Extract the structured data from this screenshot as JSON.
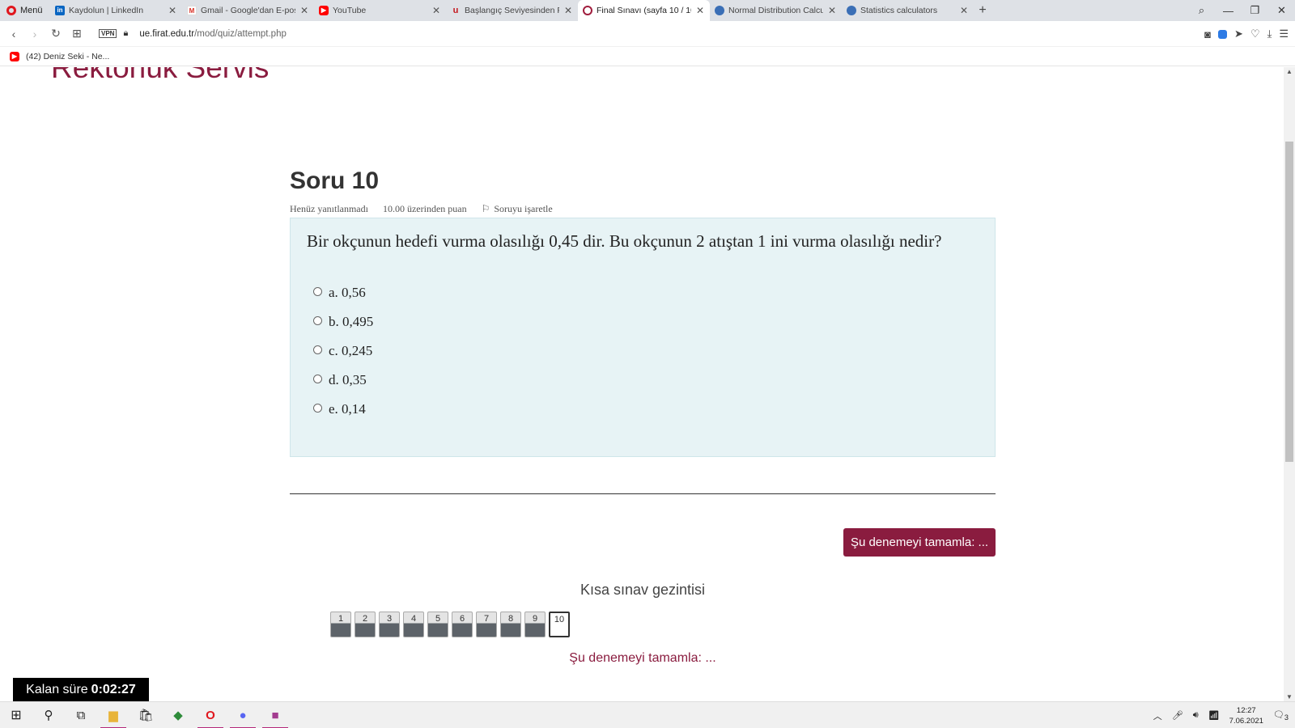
{
  "browser": {
    "menu_label": "Menü",
    "tabs": [
      {
        "title": "Kaydolun | LinkedIn",
        "favicon": "in"
      },
      {
        "title": "Gmail - Google'dan E-posta",
        "favicon": "M"
      },
      {
        "title": "YouTube",
        "favicon": "▶"
      },
      {
        "title": "Başlangıç Seviyesinden Pro",
        "favicon": "u"
      },
      {
        "title": "Final Sınavı (sayfa 10 / 10)",
        "favicon": ""
      },
      {
        "title": "Normal Distribution Calcula",
        "favicon": ""
      },
      {
        "title": "Statistics calculators",
        "favicon": ""
      }
    ],
    "url_domain": "ue.firat.edu.tr",
    "url_path": "/mod/quiz/attempt.php",
    "vpn_label": "VPN",
    "bookmark": "(42) Deniz Seki - Ne..."
  },
  "page": {
    "site_title": "Rektörlük Servis",
    "question_heading": "Soru 10",
    "status": "Henüz yanıtlanmadı",
    "points": "10.00 üzerinden puan",
    "flag_label": "Soruyu işaretle",
    "question_text": "Bir okçunun hedefi vurma olasılığı 0,45 dir. Bu okçunun 2 atıştan 1 ini vurma olasılığı nedir?",
    "answers": [
      "a. 0,56",
      "b. 0,495",
      "c. 0,245",
      "d. 0,35",
      "e. 0,14"
    ],
    "finish_button": "Şu denemeyi tamamla: ...",
    "nav_title": "Kısa sınav gezintisi",
    "nav_buttons": [
      "1",
      "2",
      "3",
      "4",
      "5",
      "6",
      "7",
      "8",
      "9",
      "10"
    ],
    "finish_link": "Şu denemeyi tamamla: ...",
    "timer_label": "Kalan süre",
    "timer_value": "0:02:27"
  },
  "taskbar": {
    "time": "12:27",
    "date": "7.06.2021",
    "notifications": "3"
  },
  "colors": {
    "brand": "#8a1c3f",
    "question_bg": "#e7f3f5"
  }
}
